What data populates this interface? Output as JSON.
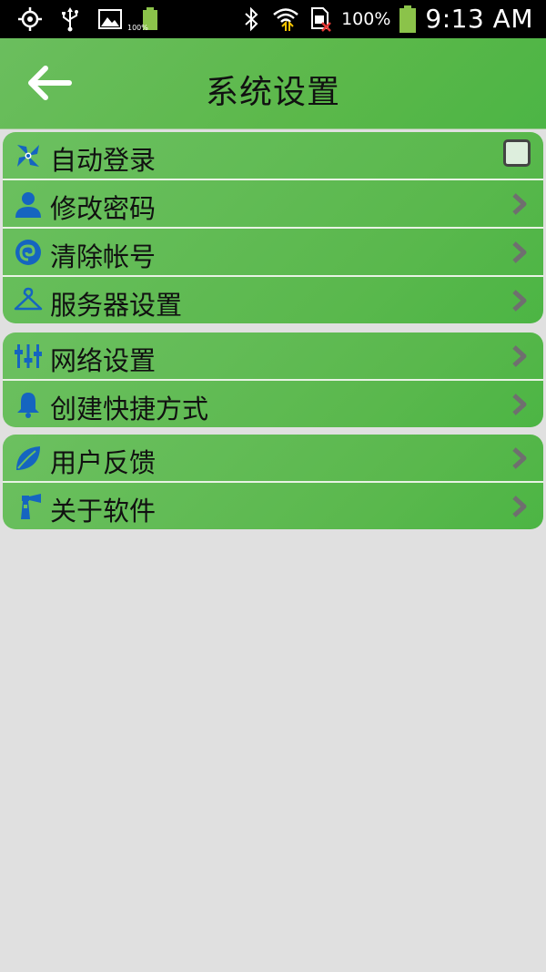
{
  "status_bar": {
    "battery_small_pct": "100%",
    "battery_pct": "100%",
    "time": "9:13 AM"
  },
  "header": {
    "title": "系统设置"
  },
  "groups": [
    {
      "items": [
        {
          "label": "自动登录",
          "icon": "pinwheel-icon",
          "control": "checkbox",
          "checked": false
        },
        {
          "label": "修改密码",
          "icon": "user-icon",
          "control": "chevron"
        },
        {
          "label": "清除帐号",
          "icon": "swirl-icon",
          "control": "chevron"
        },
        {
          "label": "服务器设置",
          "icon": "hanger-icon",
          "control": "chevron"
        }
      ]
    },
    {
      "items": [
        {
          "label": "网络设置",
          "icon": "equalizer-icon",
          "control": "chevron"
        },
        {
          "label": "创建快捷方式",
          "icon": "bell-icon",
          "control": "chevron"
        }
      ]
    },
    {
      "items": [
        {
          "label": "用户反馈",
          "icon": "leaf-icon",
          "control": "chevron"
        },
        {
          "label": "关于软件",
          "icon": "lighthouse-icon",
          "control": "chevron"
        }
      ]
    }
  ],
  "colors": {
    "header_green": "#5bb84a",
    "icon_blue": "#1565c0",
    "chevron_gray": "#6f6f6f",
    "background": "#e0e0e0"
  }
}
